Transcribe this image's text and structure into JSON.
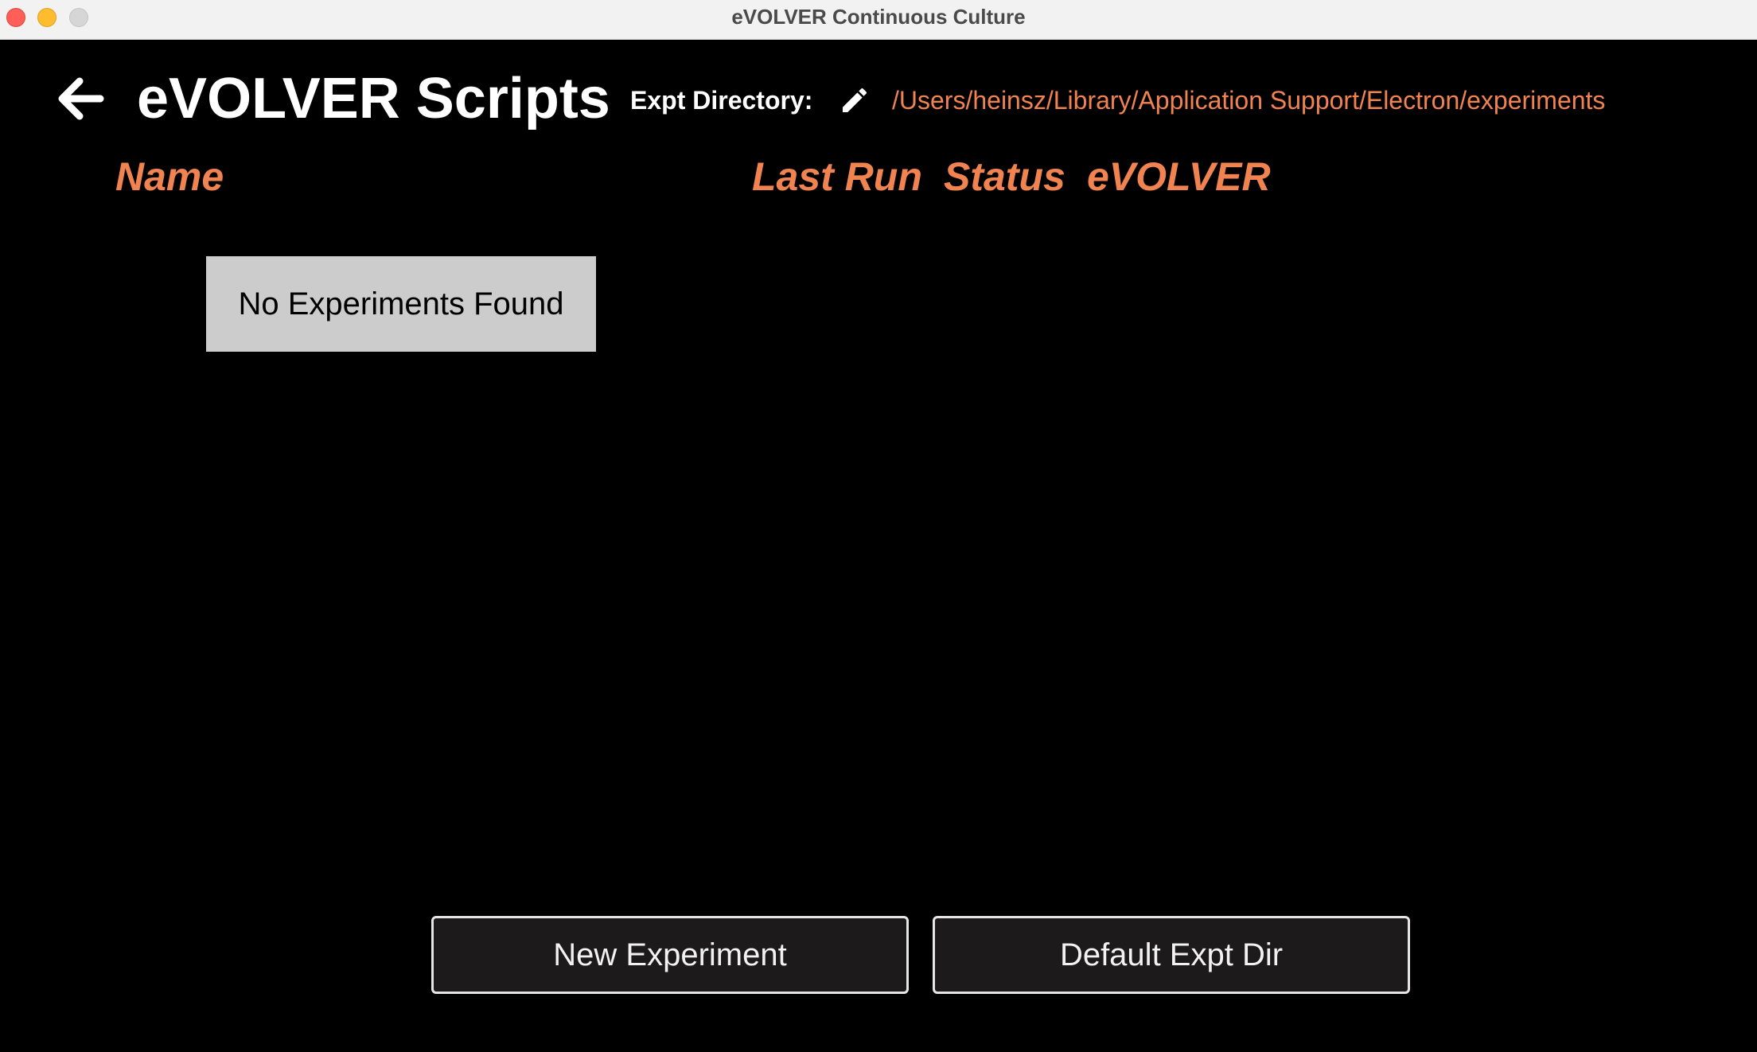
{
  "window": {
    "title": "eVOLVER Continuous Culture"
  },
  "header": {
    "title": "eVOLVER Scripts",
    "directory_label": "Expt Directory:",
    "directory_path": "/Users/heinsz/Library/Application Support/Electron/experiments"
  },
  "table": {
    "columns": [
      "Name",
      "Last Run",
      "Status",
      "eVOLVER"
    ],
    "empty_message": "No Experiments Found"
  },
  "actions": {
    "new_experiment_label": "New Experiment",
    "default_dir_label": "Default Expt Dir"
  },
  "icons": {
    "back": "arrow-left-icon",
    "edit": "pencil-icon"
  },
  "colors": {
    "background": "#000000",
    "accent": "#f0834f",
    "text": "#ffffff",
    "empty_box": "#cccccc",
    "button_bg": "#1c1a1b",
    "button_border": "#e6e6e6"
  }
}
